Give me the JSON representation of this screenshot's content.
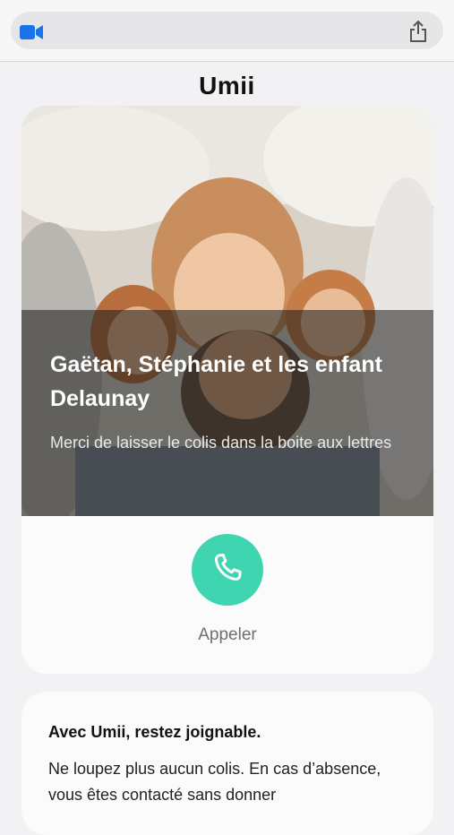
{
  "browser": {
    "video_icon": "video-camera-icon",
    "share_icon": "share-icon",
    "accent": "#1a73e8"
  },
  "brand": {
    "name": "Umii"
  },
  "profile": {
    "name": "Gaëtan, Stéphanie et les enfant Delaunay",
    "message": "Merci de laisser le colis dans la boite aux lettres",
    "call_label": "Appeler",
    "call_color": "#3fd5b1",
    "call_icon": "phone-icon"
  },
  "info": {
    "title": "Avec Umii, restez joignable.",
    "body": "Ne loupez plus aucun colis. En cas d’absence, vous êtes contacté sans donner"
  }
}
